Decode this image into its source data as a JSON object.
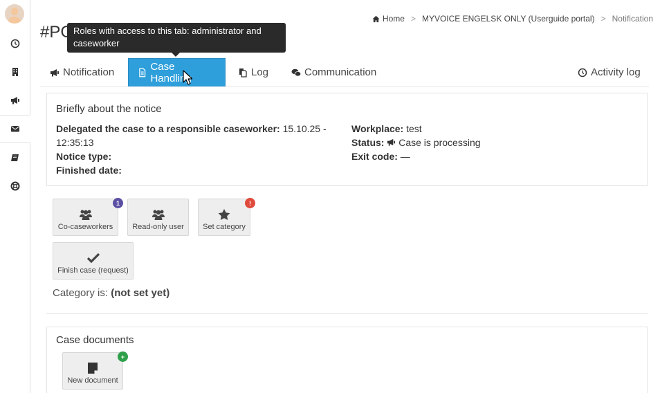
{
  "page": {
    "title": "#PG"
  },
  "breadcrumb": {
    "home": "Home",
    "portal": "MYVOICE ENGELSK ONLY (Userguide portal)",
    "current": "Notification",
    "separator": ">"
  },
  "tooltip": {
    "text": "Roles with access to this tab: administrator and caseworker"
  },
  "tabs": {
    "notification": "Notification",
    "case_handling": "Case Handling",
    "log": "Log",
    "communication": "Communication",
    "activity_log": "Activity log"
  },
  "sidebar": {
    "items": [
      {
        "icon": "clock-icon"
      },
      {
        "icon": "building-icon"
      },
      {
        "icon": "bullhorn-icon"
      },
      {
        "icon": "envelope-icon",
        "active": true
      },
      {
        "icon": "book-icon"
      },
      {
        "icon": "lifebuoy-icon"
      }
    ]
  },
  "notice": {
    "title": "Briefly about the notice",
    "delegated_label": "Delegated the case to a responsible caseworker:",
    "delegated_value_1": "15.10.25 -",
    "delegated_value_2": "12:35:13",
    "notice_type_label": "Notice type:",
    "finished_date_label": "Finished date:",
    "workplace_label": "Workplace:",
    "workplace_value": "test",
    "status_label": "Status:",
    "status_value": "Case is processing",
    "exit_code_label": "Exit code:",
    "exit_code_value": "—"
  },
  "actions": {
    "co_caseworkers": {
      "label": "Co-caseworkers",
      "badge": "1"
    },
    "read_only_user": {
      "label": "Read-only user"
    },
    "set_category": {
      "label": "Set category",
      "badge": "!"
    },
    "finish_case": {
      "label": "Finish case (request)"
    }
  },
  "category": {
    "label": "Category is:",
    "value": "(not set yet)"
  },
  "documents": {
    "title": "Case documents",
    "new_document": {
      "label": "New document",
      "badge": "+"
    }
  },
  "colors": {
    "active_tab": "#2e9fdb",
    "badge_blue": "#5a4fa3",
    "badge_red": "#e04a3c",
    "badge_green": "#2ea04a"
  }
}
